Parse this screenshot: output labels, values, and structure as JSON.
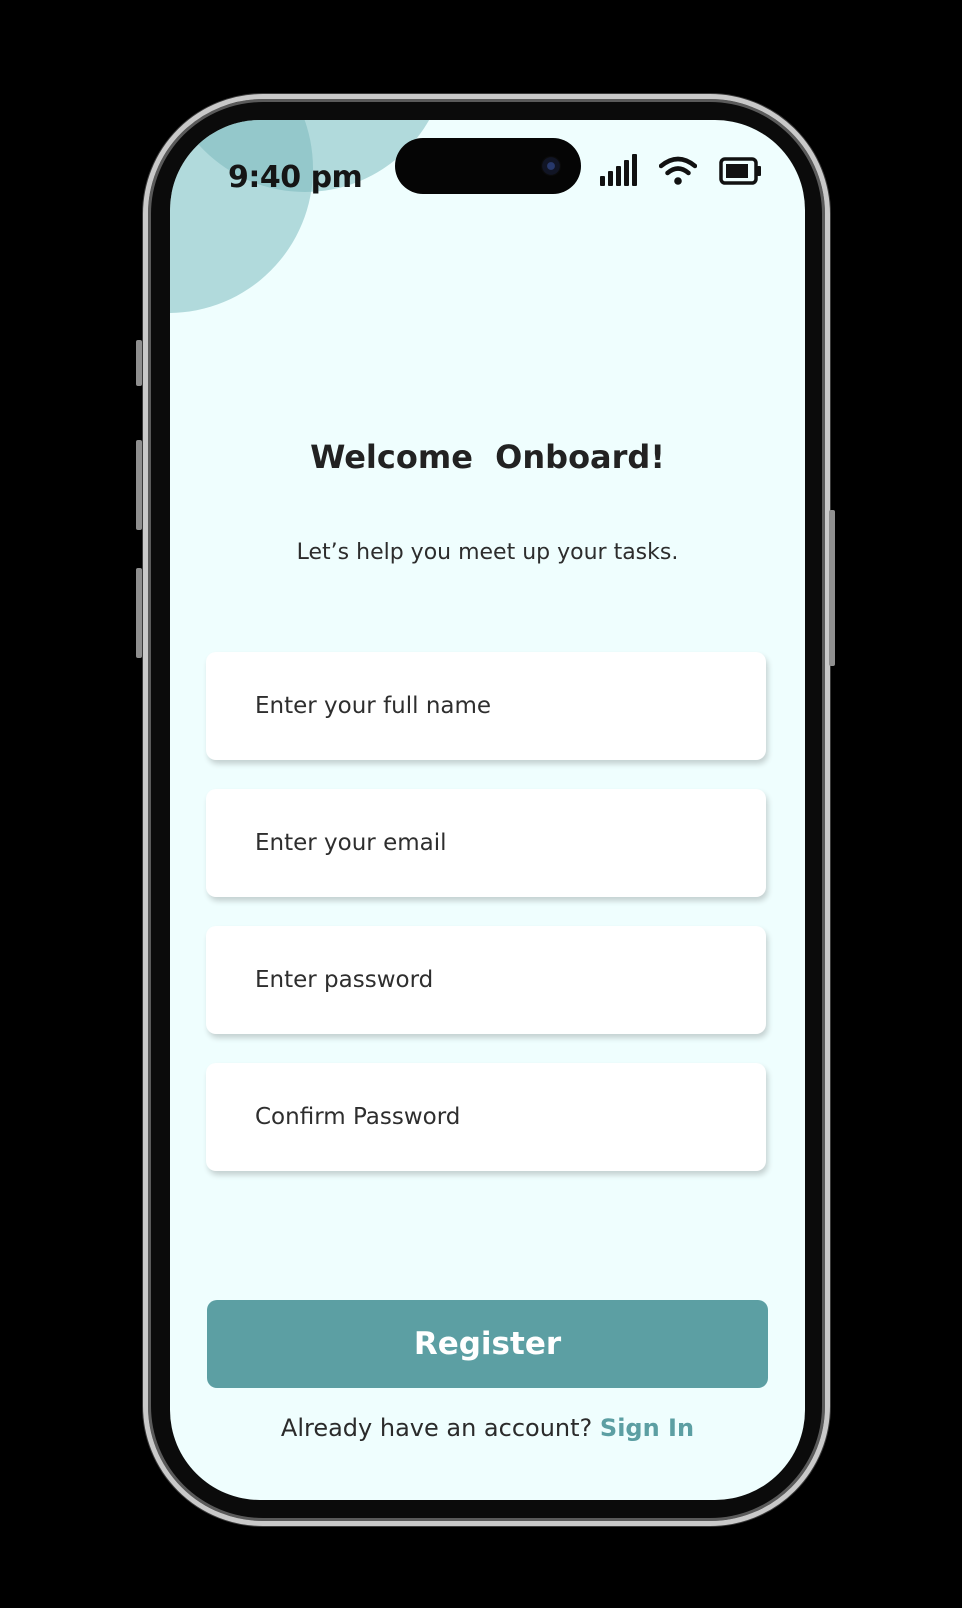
{
  "status_bar": {
    "time": "9:40 pm",
    "icons": [
      "cellular-signal-icon",
      "wifi-icon",
      "battery-icon"
    ]
  },
  "header": {
    "title": "Welcome  Onboard!",
    "subtitle": "Let’s help you meet up your tasks."
  },
  "form": {
    "full_name_placeholder": "Enter your full name",
    "email_placeholder": "Enter your email",
    "password_placeholder": "Enter password",
    "confirm_password_placeholder": "Confirm Password"
  },
  "actions": {
    "register_label": "Register",
    "signin_prompt": "Already have an account?",
    "signin_label": "Sign In"
  },
  "colors": {
    "background": "#effefe",
    "accent": "#5c9fa3",
    "decor_circle": "#78b8bc",
    "text": "#222222"
  }
}
